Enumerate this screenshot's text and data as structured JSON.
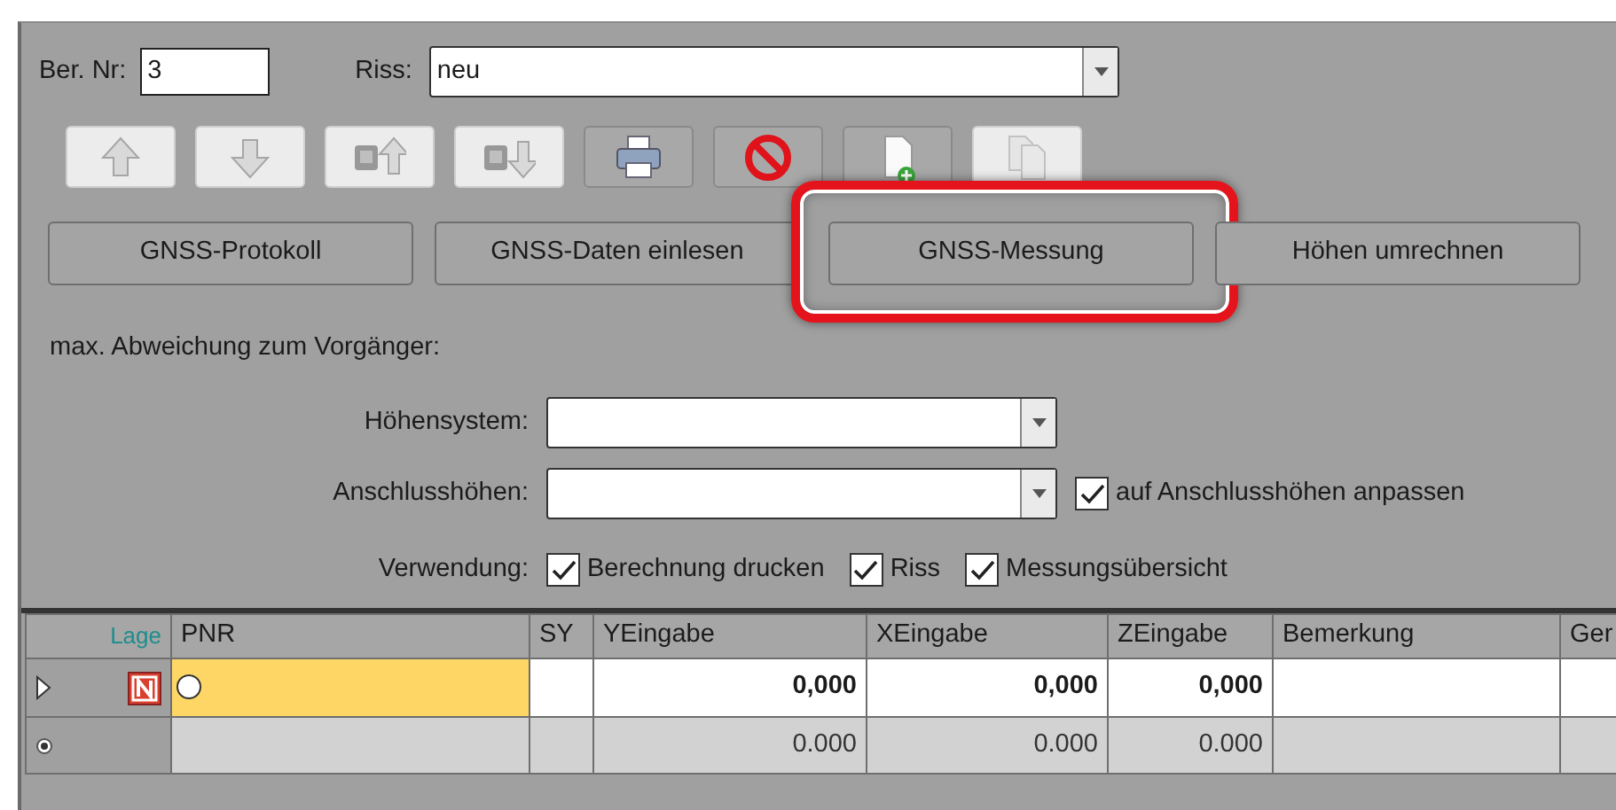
{
  "form": {
    "ber_nr": {
      "label": "Ber. Nr:",
      "value": "3"
    },
    "riss": {
      "label": "Riss:",
      "value": "neu"
    }
  },
  "toolbar": [
    {
      "disabled": true
    },
    {
      "disabled": true
    },
    {
      "disabled": true
    },
    {
      "disabled": true
    },
    {
      "disabled": false
    },
    {
      "disabled": false
    },
    {
      "disabled": false
    },
    {
      "disabled": true
    }
  ],
  "actions": [
    {
      "label": "GNSS-Protokoll",
      "highlighted": false
    },
    {
      "label": "GNSS-Daten einlesen",
      "highlighted": false
    },
    {
      "label": "GNSS-Messung",
      "highlighted": true
    },
    {
      "label": "Höhen umrechnen",
      "highlighted": false
    }
  ],
  "max_abweichung": "max. Abweichung zum Vorgänger:",
  "hoehensystem": {
    "label": "Höhensystem:"
  },
  "anschlusshoehen": {
    "label": "Anschlusshöhen:",
    "checkbox": {
      "label": "auf Anschlusshöhen anpassen",
      "checked": true
    }
  },
  "verwendung": {
    "label": "Verwendung:",
    "options": [
      {
        "label": "Berechnung drucken",
        "checked": true
      },
      {
        "label": "Riss",
        "checked": true
      },
      {
        "label": "Messungsübersicht",
        "checked": true
      }
    ]
  },
  "grid": {
    "columns": [
      "Lage",
      "PNR",
      "SY",
      "YEingabe",
      "XEingabe",
      "ZEingabe",
      "Bemerkung",
      "Ger"
    ],
    "rows": [
      {
        "kind": "current",
        "pnr_selected": true,
        "values": [
          "0,000",
          "0,000",
          "0,000"
        ]
      },
      {
        "kind": "new",
        "pnr_selected": false,
        "values": [
          "0.000",
          "0.000",
          "0.000"
        ]
      }
    ]
  }
}
